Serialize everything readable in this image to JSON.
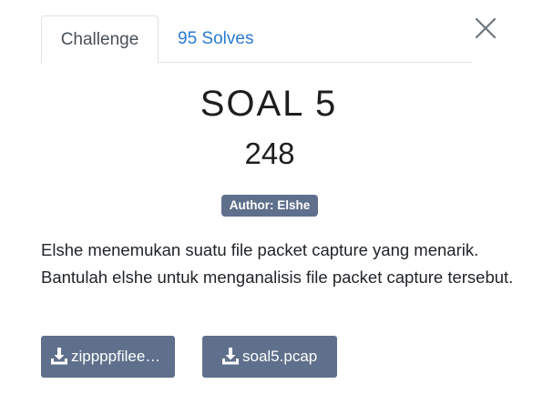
{
  "tabs": [
    {
      "label": "Challenge",
      "active": true
    },
    {
      "label": "95 Solves",
      "active": false
    }
  ],
  "challenge": {
    "name": "SOAL 5",
    "value": "248",
    "author_badge": "Author: Elshe",
    "description": "Elshe menemukan suatu file packet capture yang menarik. Bantulah elshe untuk menganalisis file packet capture tersebut."
  },
  "files": [
    {
      "label": "zippppfilee…",
      "icon": "download-icon"
    },
    {
      "label": "soal5.pcap",
      "icon": "download-icon"
    }
  ],
  "close_icon": "close-icon",
  "colors": {
    "link": "#2b7bd1",
    "badge": "#5f708c",
    "button": "#5f708c",
    "text": "#212529"
  }
}
